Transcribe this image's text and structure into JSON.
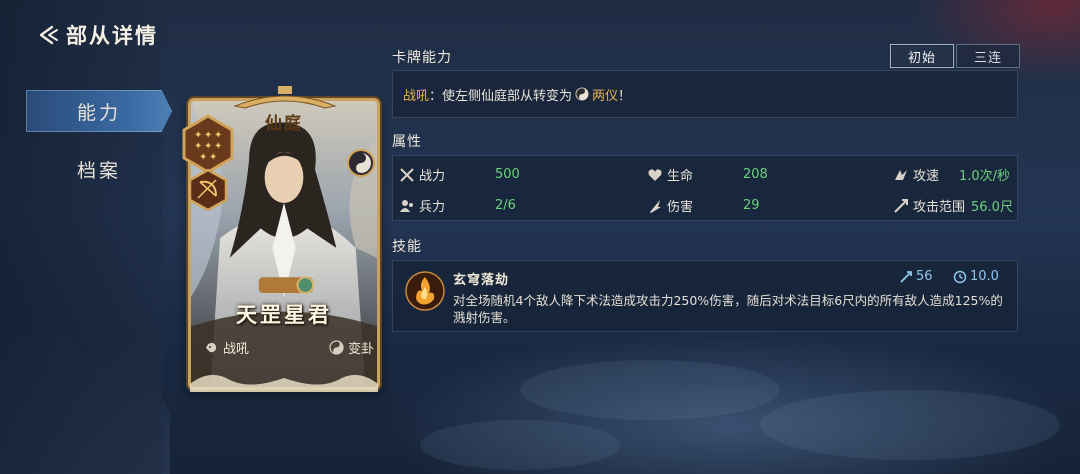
{
  "header": {
    "title": "部从详情"
  },
  "sidebar": {
    "items": [
      {
        "label": "能力",
        "active": true
      },
      {
        "label": "档案",
        "active": false
      }
    ]
  },
  "card": {
    "faction": "仙庭",
    "name": "天罡星君",
    "tags": [
      {
        "icon": "roar-icon",
        "label": "战吼"
      },
      {
        "icon": "yinyang-icon",
        "label": "变卦"
      }
    ]
  },
  "card_ability": {
    "section_label": "卡牌能力",
    "toggles": [
      {
        "label": "初始",
        "selected": true
      },
      {
        "label": "三连",
        "selected": false
      }
    ],
    "keyword": "战吼",
    "text": "：使左侧仙庭部从转变为",
    "target": "两仪",
    "end": "！"
  },
  "attributes": {
    "section_label": "属性",
    "items": [
      {
        "icon": "swords-icon",
        "label": "战力",
        "value": "500"
      },
      {
        "icon": "heart-icon",
        "label": "生命",
        "value": "208"
      },
      {
        "icon": "attack-speed-icon",
        "label": "攻速",
        "value": "1.0次/秒"
      },
      {
        "icon": "troops-icon",
        "label": "兵力",
        "value": "2/6"
      },
      {
        "icon": "damage-icon",
        "label": "伤害",
        "value": "29"
      },
      {
        "icon": "range-icon",
        "label": "攻击范围",
        "value": "56.0尺"
      }
    ]
  },
  "skills": {
    "section_label": "技能",
    "items": [
      {
        "name": "玄穹落劫",
        "icon": "skill-fire-icon",
        "cost": "56",
        "cooldown": "10.0",
        "desc": "对全场随机4个敌人降下术法造成攻击力250%伤害，随后对术法目标6尺内的所有敌人造成125%的溅射伤害。"
      }
    ]
  },
  "colors": {
    "accent_gold": "#e6b24a",
    "value_green": "#6fcf82",
    "stat_blue": "#8fc6ee",
    "nav_active": "#3a6aa2"
  }
}
